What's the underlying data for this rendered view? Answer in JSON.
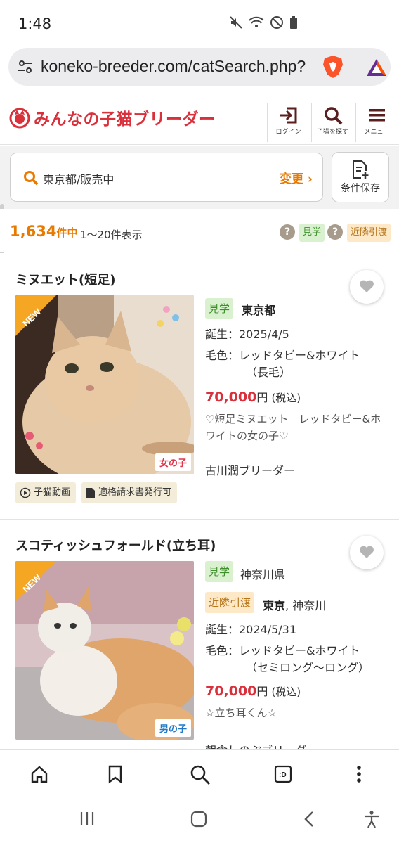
{
  "status": {
    "time": "1:48"
  },
  "browser": {
    "url": "koneko-breeder.com/catSearch.php?"
  },
  "header": {
    "logo_text": "みんなの子猫ブリーダー",
    "login_label": "ログイン",
    "search_label": "子猫を探す",
    "menu_label": "メニュー"
  },
  "search": {
    "query": "東京都/販売中",
    "change_label": "変更 ›",
    "save_label": "条件保存"
  },
  "results": {
    "count": "1,634",
    "count_unit": "件中",
    "range": "1〜20件表示",
    "visit_tag": "見学",
    "nearby_tag": "近隣引渡"
  },
  "cards": [
    {
      "title": "ミヌエット(短足)",
      "visit_tag": "見学",
      "prefecture": "東京都",
      "birth": "誕生：2025/4/5",
      "color_line1": "毛色：レッドタビー&ホワイト",
      "color_line2": "（長毛）",
      "price": "70,000",
      "price_unit": "円",
      "tax": "(税込)",
      "description": "♡短足ミヌエット　レッドタビー&ホワイトの女の子♡",
      "breeder": "古川潤ブリーダー",
      "gender": "女の子",
      "new_badge": "NEW",
      "chip_video": "子猫動画",
      "chip_invoice": "適格請求書発行可"
    },
    {
      "title": "スコティッシュフォールド(立ち耳)",
      "visit_tag": "見学",
      "prefecture": "神奈川県",
      "nearby_tag": "近隣引渡",
      "nearby_pref_bold": "東京",
      "nearby_pref_rest": ", 神奈川",
      "birth": "誕生：2024/5/31",
      "color_line1": "毛色：レッドタビー&ホワイト",
      "color_line2": "（セミロング〜ロング）",
      "price": "70,000",
      "price_unit": "円",
      "tax": "(税込)",
      "description": "☆立ち耳くん☆",
      "breeder": "朝倉しのぶブリーダー",
      "gender": "男の子",
      "new_badge": "NEW"
    }
  ],
  "colors": {
    "brand_red": "#d9303b",
    "accent_orange": "#e87a00",
    "visit_green_bg": "#d9f1cf",
    "nearby_orange_bg": "#fde9c8"
  }
}
